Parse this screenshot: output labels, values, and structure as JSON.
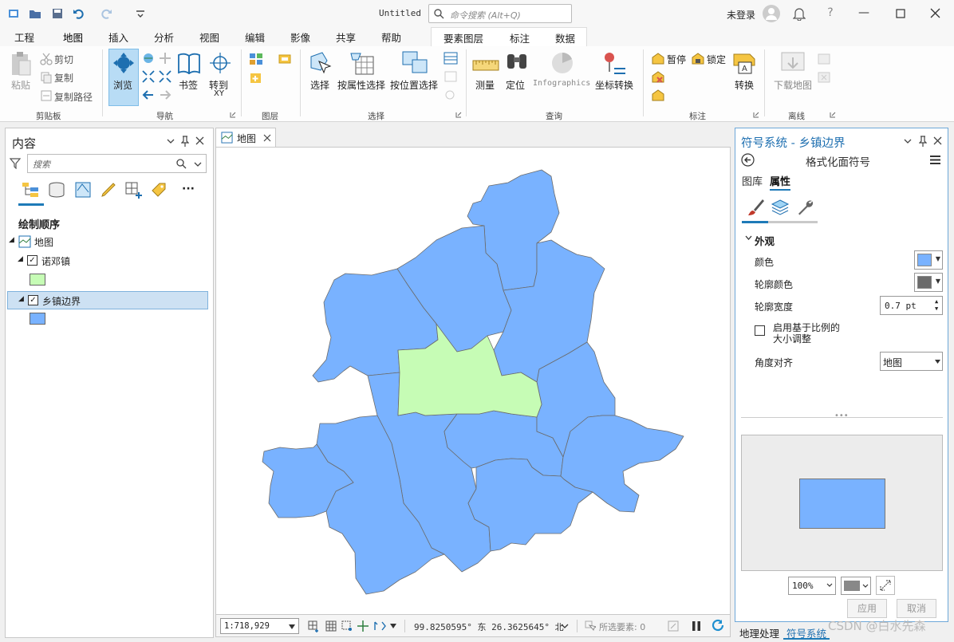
{
  "colors": {
    "accent": "#1e7ab8",
    "polygon_fill": "#79b2ff",
    "highlight_fill": "#c6fcb5",
    "outline": "#6b6b6b"
  },
  "titlebar": {
    "doc_title": "Untitled",
    "search_placeholder": "命令搜索 (Alt+Q)",
    "user": "未登录"
  },
  "ribbon_tabs": [
    "工程",
    "地图",
    "插入",
    "分析",
    "视图",
    "编辑",
    "影像",
    "共享",
    "帮助"
  ],
  "context_tabs": [
    "要素图层",
    "标注",
    "数据"
  ],
  "ribbon": {
    "clipboard": {
      "paste": "粘贴",
      "cut": "剪切",
      "copy": "复制",
      "copy_path": "复制路径",
      "label": "剪贴板"
    },
    "navigate": {
      "explore": "浏览",
      "bookmarks": "书签",
      "goto": "转到",
      "goto_sub": "XY",
      "label": "导航"
    },
    "layer": {
      "label": "图层"
    },
    "selection": {
      "select": "选择",
      "by_attr": "按属性选择",
      "by_loc": "按位置选择",
      "label": "选择"
    },
    "inquiry": {
      "measure": "测量",
      "locate": "定位",
      "infographics": "Infographics",
      "coord_convert": "坐标转换",
      "label": "查询"
    },
    "labeling": {
      "pause": "暂停",
      "lock": "锁定",
      "convert": "转换",
      "label": "标注"
    },
    "offline": {
      "download_map": "下载地图",
      "label": "离线"
    }
  },
  "contents": {
    "title": "内容",
    "search_placeholder": "搜索",
    "draw_order": "绘制顺序",
    "map_name": "地图",
    "layers": [
      {
        "name": "诺邓镇",
        "checked": true,
        "color": "#c6fcb5"
      },
      {
        "name": "乡镇边界",
        "checked": true,
        "color": "#79b2ff"
      }
    ]
  },
  "map_tab": {
    "label": "地图"
  },
  "statusbar": {
    "scale": "1:718,929",
    "coords": "99.8250595° 东 26.3625645° 北",
    "selected": "所选要素: 0"
  },
  "symbology": {
    "title": "符号系统 - 乡镇边界",
    "subtitle": "格式化面符号",
    "tab_gallery": "图库",
    "tab_properties": "属性",
    "appearance": "外观",
    "color_label": "颜色",
    "outline_color_label": "轮廓颜色",
    "outline_width_label": "轮廓宽度",
    "outline_width_value": "0.7 pt",
    "scale_sizing_label_1": "启用基于比例的",
    "scale_sizing_label_2": "大小调整",
    "angle_label": "角度对齐",
    "angle_value": "地图",
    "fill_color": "#79b2ff",
    "outline_color": "#6b6b6b",
    "zoom": "100%",
    "apply": "应用",
    "cancel": "取消"
  },
  "bottom_tabs": [
    "地理处理",
    "符号系统"
  ],
  "watermark": "CSDN @白水先森"
}
